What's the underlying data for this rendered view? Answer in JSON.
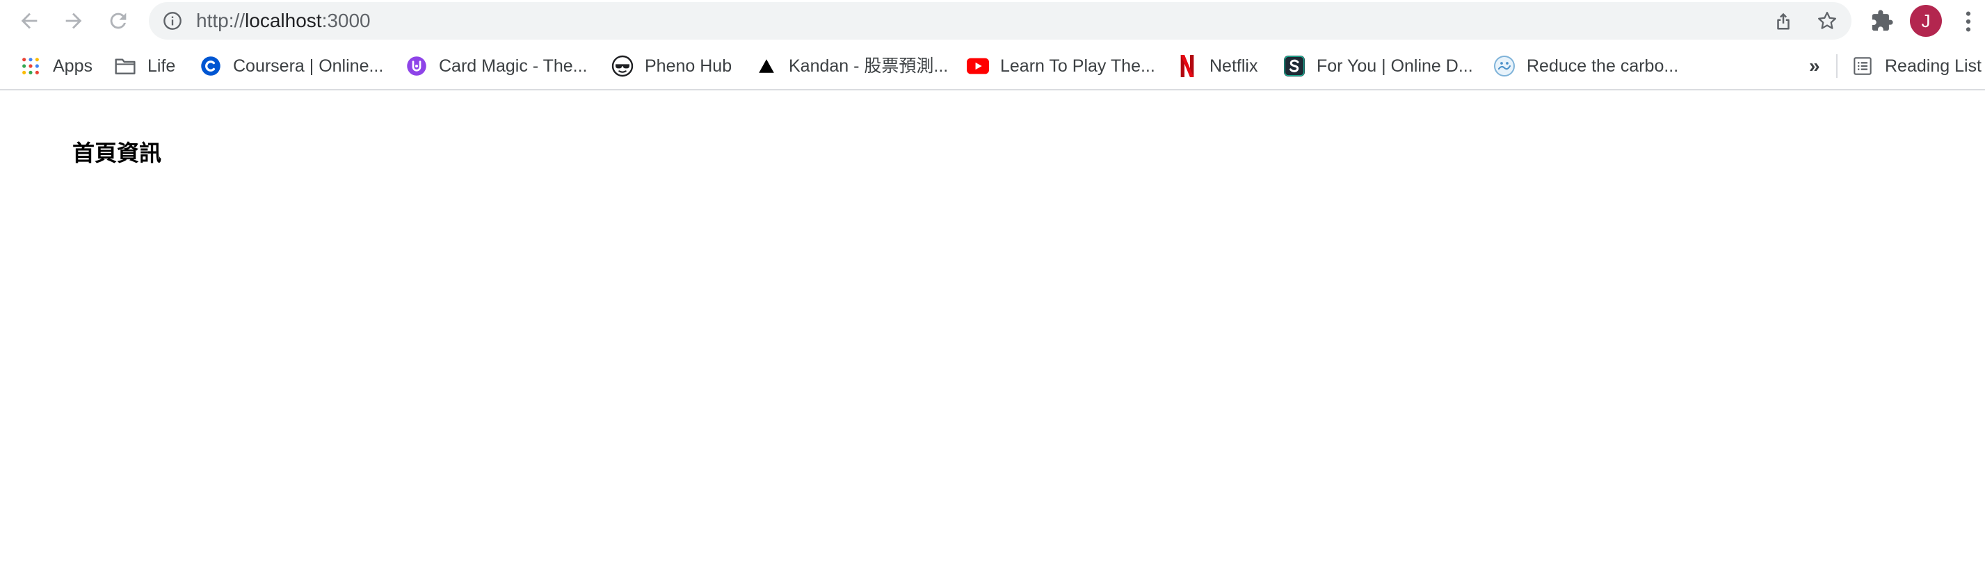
{
  "browser": {
    "url_scheme": "http://",
    "url_host": "localhost",
    "url_port": ":3000",
    "profile_initial": "J",
    "profile_color": "#b3264f"
  },
  "bookmarks": [
    {
      "label": "Apps",
      "icon": "apps-grid-icon"
    },
    {
      "label": "Life",
      "icon": "folder-icon"
    },
    {
      "label": "Coursera | Online...",
      "icon": "coursera-icon"
    },
    {
      "label": "Card Magic - The...",
      "icon": "card-magic-icon"
    },
    {
      "label": "Pheno Hub",
      "icon": "pheno-hub-icon"
    },
    {
      "label": "Kandan - 股票預測...",
      "icon": "kandan-icon"
    },
    {
      "label": "Learn To Play The...",
      "icon": "youtube-icon"
    },
    {
      "label": "Netflix",
      "icon": "netflix-icon"
    },
    {
      "label": "For You | Online D...",
      "icon": "scribd-icon"
    },
    {
      "label": "Reduce the carbo...",
      "icon": "reduce-carbon-icon"
    }
  ],
  "bookmarks_overflow": "»",
  "reading_list": {
    "label": "Reading List",
    "icon": "reading-list-icon"
  },
  "page": {
    "title": "首頁資訊"
  }
}
